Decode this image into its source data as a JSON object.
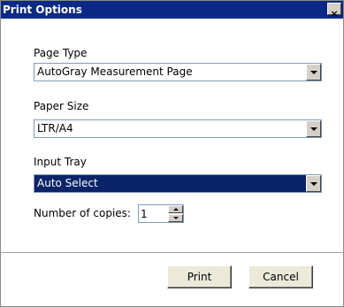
{
  "window": {
    "title": "Print Options",
    "close_glyph": "×"
  },
  "page_type": {
    "label": "Page Type",
    "value": "AutoGray Measurement Page"
  },
  "paper_size": {
    "label": "Paper Size",
    "value": "LTR/A4"
  },
  "input_tray": {
    "label": "Input Tray",
    "value": "Auto Select"
  },
  "copies": {
    "label": "Number of copies:",
    "value": "1"
  },
  "buttons": {
    "print": "Print",
    "cancel": "Cancel"
  },
  "colors": {
    "titlebar": "#0b2a85",
    "selection": "#0a246a"
  },
  "icons": {
    "close": "close-icon",
    "dropdown": "chevron-down-icon",
    "spin_up": "spin-up-icon",
    "spin_down": "spin-down-icon"
  }
}
